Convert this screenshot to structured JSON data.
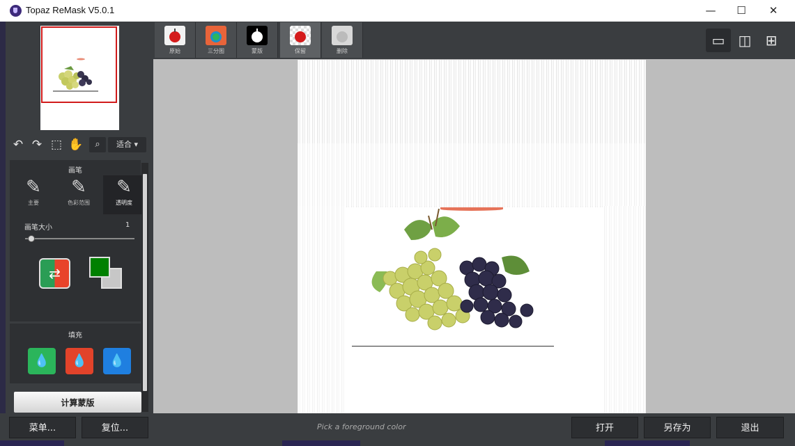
{
  "window": {
    "title": "Topaz ReMask V5.0.1",
    "minimize_glyph": "—",
    "maximize_glyph": "☐",
    "close_glyph": "✕"
  },
  "toolbar": {
    "undo_glyph": "↶",
    "redo_glyph": "↷",
    "select_glyph": "⬚",
    "hand_glyph": "✋",
    "zoom_glyph": "⌕",
    "zoom_value": "适合 ▾"
  },
  "brush": {
    "section_title": "画笔",
    "tools": [
      {
        "label": "主要",
        "glyph": "✎"
      },
      {
        "label": "色彩范围",
        "glyph": "✎"
      },
      {
        "label": "透明度",
        "glyph": "✎"
      }
    ],
    "size_label": "画笔大小",
    "size_value": "1",
    "size_fraction": 0.05,
    "swap_glyph": "⇄",
    "foreground_color": "#008000",
    "background_color": "#c7c7c7"
  },
  "fill": {
    "section_title": "填充",
    "buttons": [
      {
        "glyph": "💧",
        "color": "#2bb55b"
      },
      {
        "glyph": "💧",
        "color": "#e2432a"
      },
      {
        "glyph": "💧",
        "color": "#1f7fe0"
      }
    ]
  },
  "compute_label": "计算蒙版",
  "modes": [
    {
      "label": "原始",
      "icon": "apple-icon"
    },
    {
      "label": "三分图",
      "icon": "apple-trimap-icon"
    },
    {
      "label": "蒙版",
      "icon": "apple-mask-icon"
    },
    {
      "label": "保留",
      "icon": "apple-keep-icon"
    },
    {
      "label": "删除",
      "icon": "apple-remove-icon"
    }
  ],
  "views": {
    "single_glyph": "▭",
    "split_glyph": "◫",
    "quad_glyph": "⊞"
  },
  "bottom": {
    "menu_label": "菜单...",
    "reset_label": "复位...",
    "status": "Pick a foreground color",
    "open_label": "打开",
    "save_as_label": "另存为",
    "exit_label": "退出"
  }
}
